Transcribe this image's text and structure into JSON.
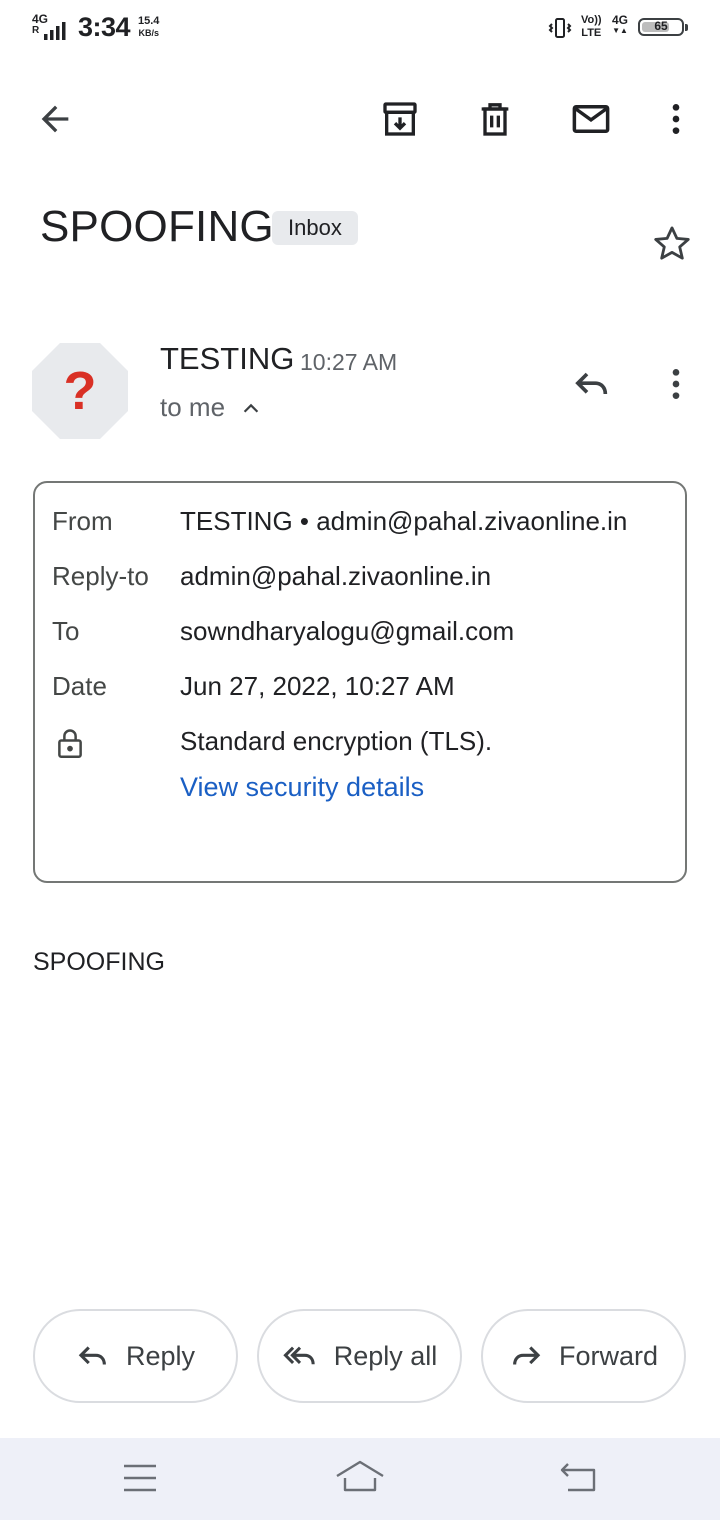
{
  "status_bar": {
    "network_top": "4G",
    "network_bottom": "R",
    "time": "3:34",
    "speed_value": "15.4",
    "speed_unit": "KB/s",
    "volte_top": "Vo))",
    "volte_bottom": "LTE",
    "data_type": "4G",
    "battery_level": "65",
    "icons": [
      "signal-bars-icon",
      "vibrate-icon",
      "battery-icon"
    ]
  },
  "toolbar": {
    "icons": [
      "back-arrow-icon",
      "archive-icon",
      "delete-icon",
      "mark-unread-icon",
      "more-vert-icon"
    ]
  },
  "email": {
    "subject": "SPOOFING",
    "label_chip": "Inbox",
    "sender_name": "TESTING",
    "time": "10:27 AM",
    "recipient_summary": "to me",
    "avatar_glyph": "?",
    "body": "SPOOFING"
  },
  "details": {
    "from_label": "From",
    "from_value": "TESTING • admin@pahal.zivaonline.in",
    "reply_to_label": "Reply-to",
    "reply_to_value": "admin@pahal.zivaonline.in",
    "to_label": "To",
    "to_value": "sowndharyalogu@gmail.com",
    "date_label": "Date",
    "date_value": "Jun 27, 2022, 10:27 AM",
    "encryption_value": "Standard encryption (TLS).",
    "security_link": "View security details"
  },
  "actions": {
    "reply": "Reply",
    "reply_all": "Reply all",
    "forward": "Forward"
  },
  "colors": {
    "link": "#1a5fc4",
    "avatar_bg": "#e8eaed",
    "avatar_glyph": "#d93025",
    "navbar_bg": "#eef0f8"
  }
}
